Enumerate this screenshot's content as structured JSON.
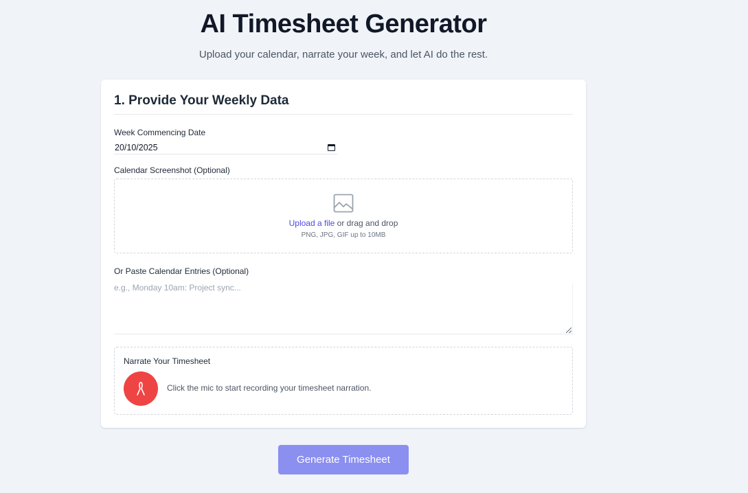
{
  "header": {
    "title": "AI Timesheet Generator",
    "subtitle": "Upload your calendar, narrate your week, and let AI do the rest."
  },
  "card": {
    "heading": "1. Provide Your Weekly Data",
    "date_field": {
      "label": "Week Commencing Date",
      "value": "20/10/2025"
    },
    "calendar_upload": {
      "label": "Calendar Screenshot (Optional)",
      "link_text": "Upload a file",
      "rest_text": " or drag and drop",
      "hint": "PNG, JPG, GIF up to 10MB"
    },
    "paste_entries": {
      "label": "Or Paste Calendar Entries (Optional)",
      "placeholder": "e.g., Monday 10am: Project sync..."
    },
    "narration": {
      "title": "Narrate Your Timesheet",
      "status": "Click the mic to start recording your timesheet narration."
    }
  },
  "actions": {
    "generate_label": "Generate Timesheet"
  },
  "colors": {
    "accent": "#4f46e5",
    "mic": "#ef4444",
    "button": "#8b8ff0",
    "background": "#f0f3f8"
  },
  "icons": [
    "calendar-icon",
    "image-icon",
    "microphone-icon"
  ]
}
